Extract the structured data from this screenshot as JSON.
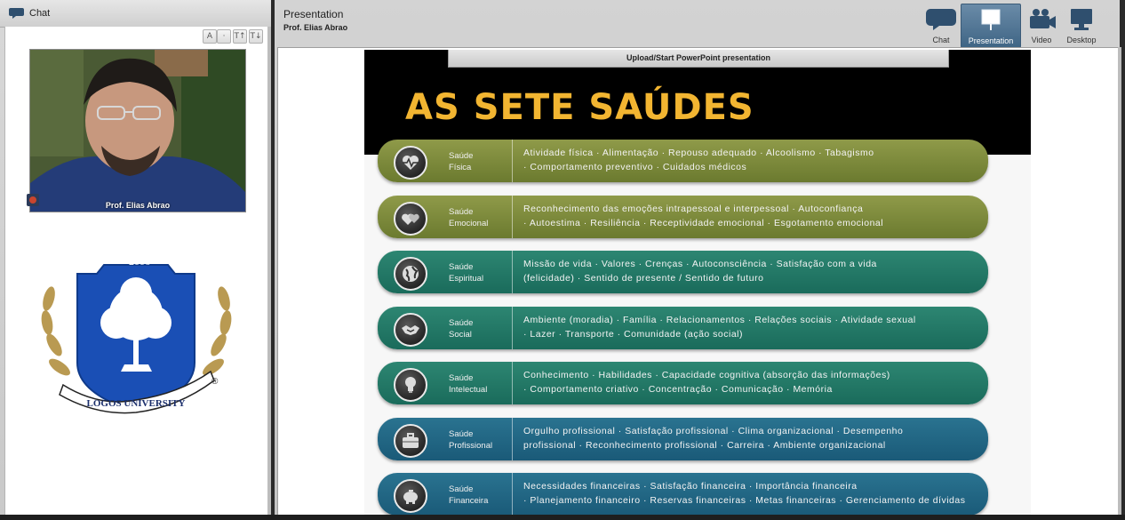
{
  "chat_panel": {
    "title": "Chat",
    "tools": [
      "A",
      "·",
      "T↑",
      "T↓"
    ],
    "webcam_name": "Prof. Elias Abrao"
  },
  "logo": {
    "year": "2006",
    "name": "LOGOS UNIVERSITY",
    "reg": "®"
  },
  "presentation": {
    "title": "Presentation",
    "presenter": "Prof. Elias Abrao",
    "upload_label": "Upload/Start PowerPoint presentation",
    "modes": [
      {
        "label": "Chat",
        "icon": "chat-icon"
      },
      {
        "label": "Presentation",
        "icon": "presentation-icon"
      },
      {
        "label": "Video",
        "icon": "video-camera-icon"
      },
      {
        "label": "Desktop",
        "icon": "desktop-icon"
      }
    ],
    "active_mode": "Presentation"
  },
  "slide": {
    "title": "AS SETE SAÚDES",
    "rows": [
      {
        "cat1": "Saúde",
        "cat2": "Física",
        "icon": "heartbeat-icon",
        "line1": "Atividade física · Alimentação · Repouso adequado · Alcoolismo · Tabagismo",
        "line2": "· Comportamento preventivo · Cuidados médicos"
      },
      {
        "cat1": "Saúde",
        "cat2": "Emocional",
        "icon": "hearts-icon",
        "line1": "Reconhecimento das emoções intrapessoal e interpessoal · Autoconfiança",
        "line2": "· Autoestima · Resiliência · Receptividade emocional · Esgotamento emocional"
      },
      {
        "cat1": "Saúde",
        "cat2": "Espiritual",
        "icon": "globe-icon",
        "line1": "Missão de vida · Valores · Crenças · Autoconsciência · Satisfação com a vida",
        "line2": "(felicidade) · Sentido de presente / Sentido de futuro"
      },
      {
        "cat1": "Saúde",
        "cat2": "Social",
        "icon": "handshake-icon",
        "line1": "Ambiente (moradia) · Família · Relacionamentos · Relações sociais · Atividade sexual",
        "line2": "· Lazer · Transporte · Comunidade (ação social)"
      },
      {
        "cat1": "Saúde",
        "cat2": "Intelectual",
        "icon": "lightbulb-icon",
        "line1": "Conhecimento · Habilidades · Capacidade cognitiva (absorção das informações)",
        "line2": "· Comportamento criativo · Concentração · Comunicação · Memória"
      },
      {
        "cat1": "Saúde",
        "cat2": "Profissional",
        "icon": "briefcase-icon",
        "line1": "Orgulho profissional · Satisfação profissional · Clima organizacional · Desempenho",
        "line2": "profissional · Reconhecimento profissional · Carreira · Ambiente organizacional"
      },
      {
        "cat1": "Saúde",
        "cat2": "Financeira",
        "icon": "piggy-bank-icon",
        "line1": "Necessidades financeiras · Satisfação financeira · Importância financeira",
        "line2": "· Planejamento financeiro · Reservas financeiras · Metas financeiras · Gerenciamento de dívidas"
      }
    ]
  }
}
